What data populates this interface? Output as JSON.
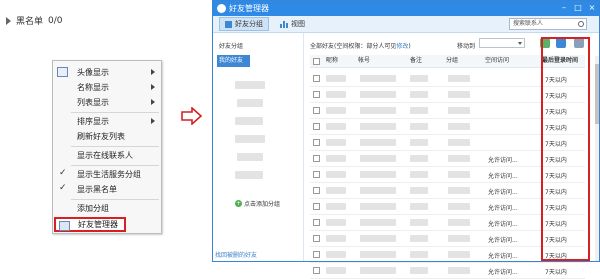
{
  "left": {
    "blacklist_label": "黑名单",
    "blacklist_count": "0/0"
  },
  "context_menu": {
    "items": [
      {
        "label": "头像显示",
        "submenu": true
      },
      {
        "label": "名称显示",
        "submenu": true
      },
      {
        "label": "列表显示",
        "submenu": true
      },
      {
        "label": "排序显示",
        "submenu": true
      },
      {
        "label": "刷新好友列表",
        "submenu": false
      },
      {
        "label": "显示在线联系人",
        "submenu": false
      },
      {
        "label": "显示生活服务分组",
        "checked": true
      },
      {
        "label": "显示黑名单",
        "checked": true
      },
      {
        "label": "添加分组",
        "submenu": false
      },
      {
        "label": "好友管理器",
        "highlighted": true
      }
    ]
  },
  "window": {
    "title": "好友管理器",
    "search_placeholder": "搜索联系人",
    "toolbar": {
      "group_label": "好友分组",
      "view_label": "视图"
    },
    "sidebar": {
      "heading": "好友分组",
      "selected_group": "我的好友",
      "add_group": "点击添加分组",
      "footer_link": "找回被删的好友"
    },
    "main": {
      "header_prefix": "全部好友(空间权限：部分人可见",
      "header_link": "修改",
      "header_suffix": ")",
      "move_to": "移动到",
      "columns": [
        "昵称",
        "帐号",
        "备注",
        "分组",
        "空间访问",
        "最后登录时间"
      ],
      "space_access": [
        "",
        "",
        "",
        "",
        "",
        "允许访问...",
        "允许访问...",
        "允许访问...",
        "允许访问...",
        "允许访问...",
        "允许访问...",
        "允许访问...",
        "允许访问..."
      ],
      "last_login": [
        "7天以内",
        "7天以内",
        "7天以内",
        "7天以内",
        "7天以内",
        "7天以内",
        "7天以内",
        "7天以内",
        "7天以内",
        "7天以内",
        "7天以内",
        "7天以内",
        "7天以内"
      ]
    }
  },
  "colors": {
    "title_bar": "#2f8ae6",
    "highlight_red": "#d92020",
    "accent_blue": "#3d87d4"
  }
}
